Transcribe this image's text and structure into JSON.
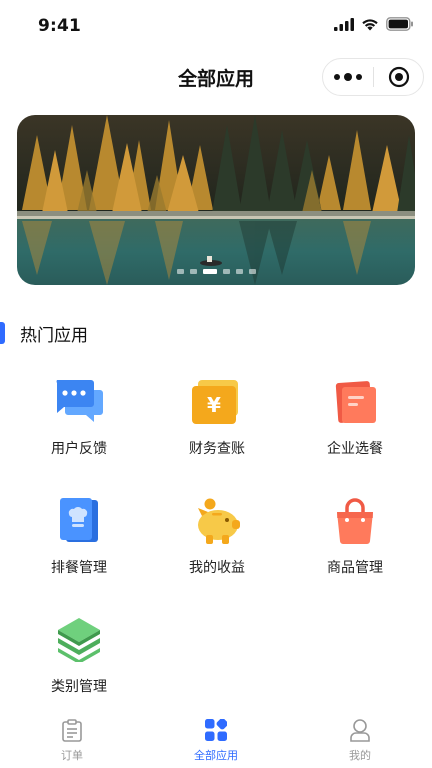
{
  "status_bar": {
    "time": "9:41"
  },
  "nav": {
    "title": "全部应用"
  },
  "banner": {
    "dot_count": 6,
    "active_index": 2
  },
  "section": {
    "title": "热门应用"
  },
  "apps": [
    {
      "label": "用户反馈",
      "icon": "chat-bubble-icon"
    },
    {
      "label": "财务查账",
      "icon": "yuan-wallet-icon"
    },
    {
      "label": "企业选餐",
      "icon": "card-icon"
    },
    {
      "label": "排餐管理",
      "icon": "chef-book-icon"
    },
    {
      "label": "我的收益",
      "icon": "piggy-bank-icon"
    },
    {
      "label": "商品管理",
      "icon": "shopping-bag-icon"
    },
    {
      "label": "类别管理",
      "icon": "layers-icon"
    }
  ],
  "tabs": [
    {
      "label": "订单",
      "icon": "clipboard-icon",
      "active": false
    },
    {
      "label": "全部应用",
      "icon": "apps-grid-icon",
      "active": true
    },
    {
      "label": "我的",
      "icon": "user-icon",
      "active": false
    }
  ],
  "colors": {
    "accent": "#2f6bff",
    "tab_inactive": "#999999"
  }
}
